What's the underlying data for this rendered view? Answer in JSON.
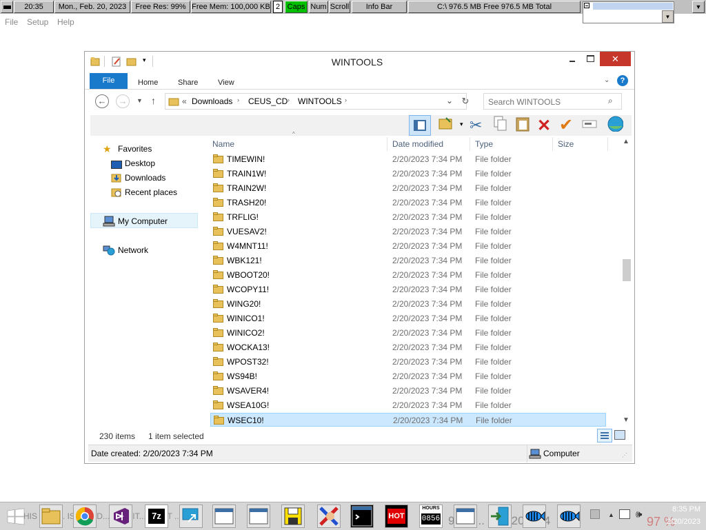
{
  "infobar": {
    "time": "20:35",
    "date": "Mon., Feb. 20, 2023",
    "free_res": "Free Res: 99%",
    "free_mem": "Free Mem: 100,000 KB",
    "counter": "2",
    "caps": "Caps",
    "num": "Num",
    "scroll": "Scroll",
    "title": "Info Bar",
    "disk": "C:\\ 976.5 MB Free  976.5 MB Total"
  },
  "menu": {
    "file": "File",
    "setup": "Setup",
    "help": "Help"
  },
  "window": {
    "title": "WINTOOLS",
    "ribbon_tabs": [
      "File",
      "Home",
      "Share",
      "View"
    ],
    "breadcrumb": {
      "lead": "«",
      "items": [
        "Downloads",
        "CEUS_CD",
        "WINTOOLS"
      ]
    },
    "search_placeholder": "Search WINTOOLS",
    "columns": {
      "name": "Name",
      "date": "Date modified",
      "type": "Type",
      "size": "Size"
    },
    "nav": {
      "favorites": "Favorites",
      "desktop": "Desktop",
      "downloads": "Downloads",
      "recent": "Recent places",
      "computer": "My Computer",
      "network": "Network"
    },
    "rows": [
      {
        "name": "TIMEWIN!",
        "date": "2/20/2023 7:34 PM",
        "type": "File folder"
      },
      {
        "name": "TRAIN1W!",
        "date": "2/20/2023 7:34 PM",
        "type": "File folder"
      },
      {
        "name": "TRAIN2W!",
        "date": "2/20/2023 7:34 PM",
        "type": "File folder"
      },
      {
        "name": "TRASH20!",
        "date": "2/20/2023 7:34 PM",
        "type": "File folder"
      },
      {
        "name": "TRFLIG!",
        "date": "2/20/2023 7:34 PM",
        "type": "File folder"
      },
      {
        "name": "VUESAV2!",
        "date": "2/20/2023 7:34 PM",
        "type": "File folder"
      },
      {
        "name": "W4MNT11!",
        "date": "2/20/2023 7:34 PM",
        "type": "File folder"
      },
      {
        "name": "WBK121!",
        "date": "2/20/2023 7:34 PM",
        "type": "File folder"
      },
      {
        "name": "WBOOT20!",
        "date": "2/20/2023 7:34 PM",
        "type": "File folder"
      },
      {
        "name": "WCOPY11!",
        "date": "2/20/2023 7:34 PM",
        "type": "File folder"
      },
      {
        "name": "WING20!",
        "date": "2/20/2023 7:34 PM",
        "type": "File folder"
      },
      {
        "name": "WINICO1!",
        "date": "2/20/2023 7:34 PM",
        "type": "File folder"
      },
      {
        "name": "WINICO2!",
        "date": "2/20/2023 7:34 PM",
        "type": "File folder"
      },
      {
        "name": "WOCKA13!",
        "date": "2/20/2023 7:34 PM",
        "type": "File folder"
      },
      {
        "name": "WPOST32!",
        "date": "2/20/2023 7:34 PM",
        "type": "File folder"
      },
      {
        "name": "WS94B!",
        "date": "2/20/2023 7:34 PM",
        "type": "File folder"
      },
      {
        "name": "WSAVER4!",
        "date": "2/20/2023 7:34 PM",
        "type": "File folder"
      },
      {
        "name": "WSEA10G!",
        "date": "2/20/2023 7:34 PM",
        "type": "File folder"
      },
      {
        "name": "WSEC10!",
        "date": "2/20/2023 7:34 PM",
        "type": "File folder",
        "selected": true
      }
    ],
    "status": {
      "count": "230 items",
      "selected": "1 item selected"
    },
    "details": {
      "created": "Date created: 2/20/2023 7:34 PM",
      "location": "Computer"
    }
  },
  "taskbar": {
    "hot_label": "HOT",
    "hours_label": "HOURS",
    "hours_value": "0856",
    "clock_time": "8:35 PM",
    "clock_date": "2/20/2023",
    "marquee_text": "HIS ... TY... IS ... WID... AS ISIT... WANT ...",
    "ghost_clock": "99% ... Feb 20 8:34",
    "ghost_right": "97 %"
  },
  "colors": {
    "accent": "#1979ca",
    "selected_row": "#cce8ff",
    "selected_border": "#99d1ff",
    "caps_on": "#00c000"
  }
}
